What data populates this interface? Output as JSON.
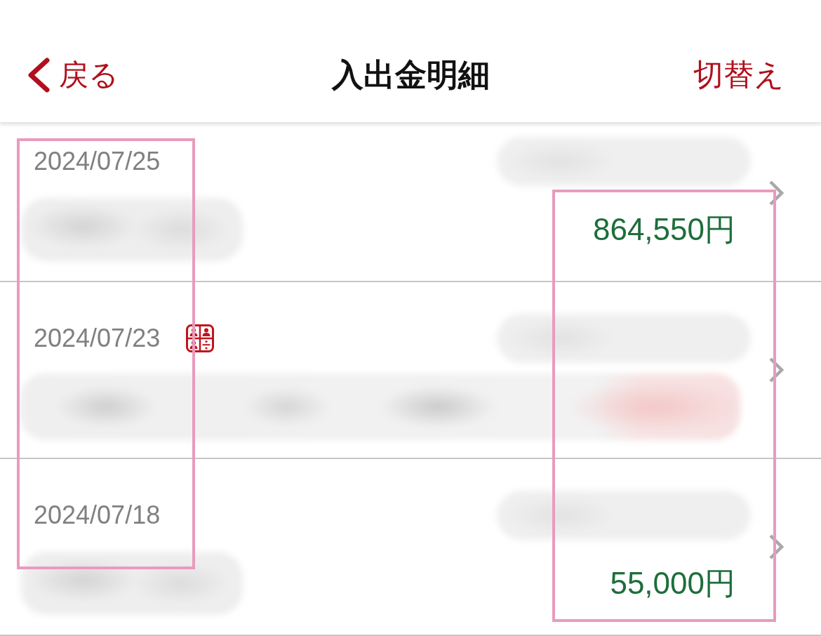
{
  "header": {
    "back_label": "戻る",
    "title": "入出金明細",
    "action_label": "切替え"
  },
  "transactions": [
    {
      "date": "2024/07/25",
      "split_icon": false,
      "blurred": [
        {
          "kind": "label"
        },
        {
          "kind": "description"
        }
      ],
      "amount": "864,550円"
    },
    {
      "date": "2024/07/23",
      "split_icon": true,
      "blurred": [
        {
          "kind": "label"
        },
        {
          "kind": "detail_line"
        }
      ]
    },
    {
      "date": "2024/07/18",
      "split_icon": false,
      "blurred": [
        {
          "kind": "label"
        },
        {
          "kind": "description"
        }
      ],
      "amount": "55,000円"
    }
  ],
  "highlights": {
    "date_column": true,
    "amount_column": true
  }
}
